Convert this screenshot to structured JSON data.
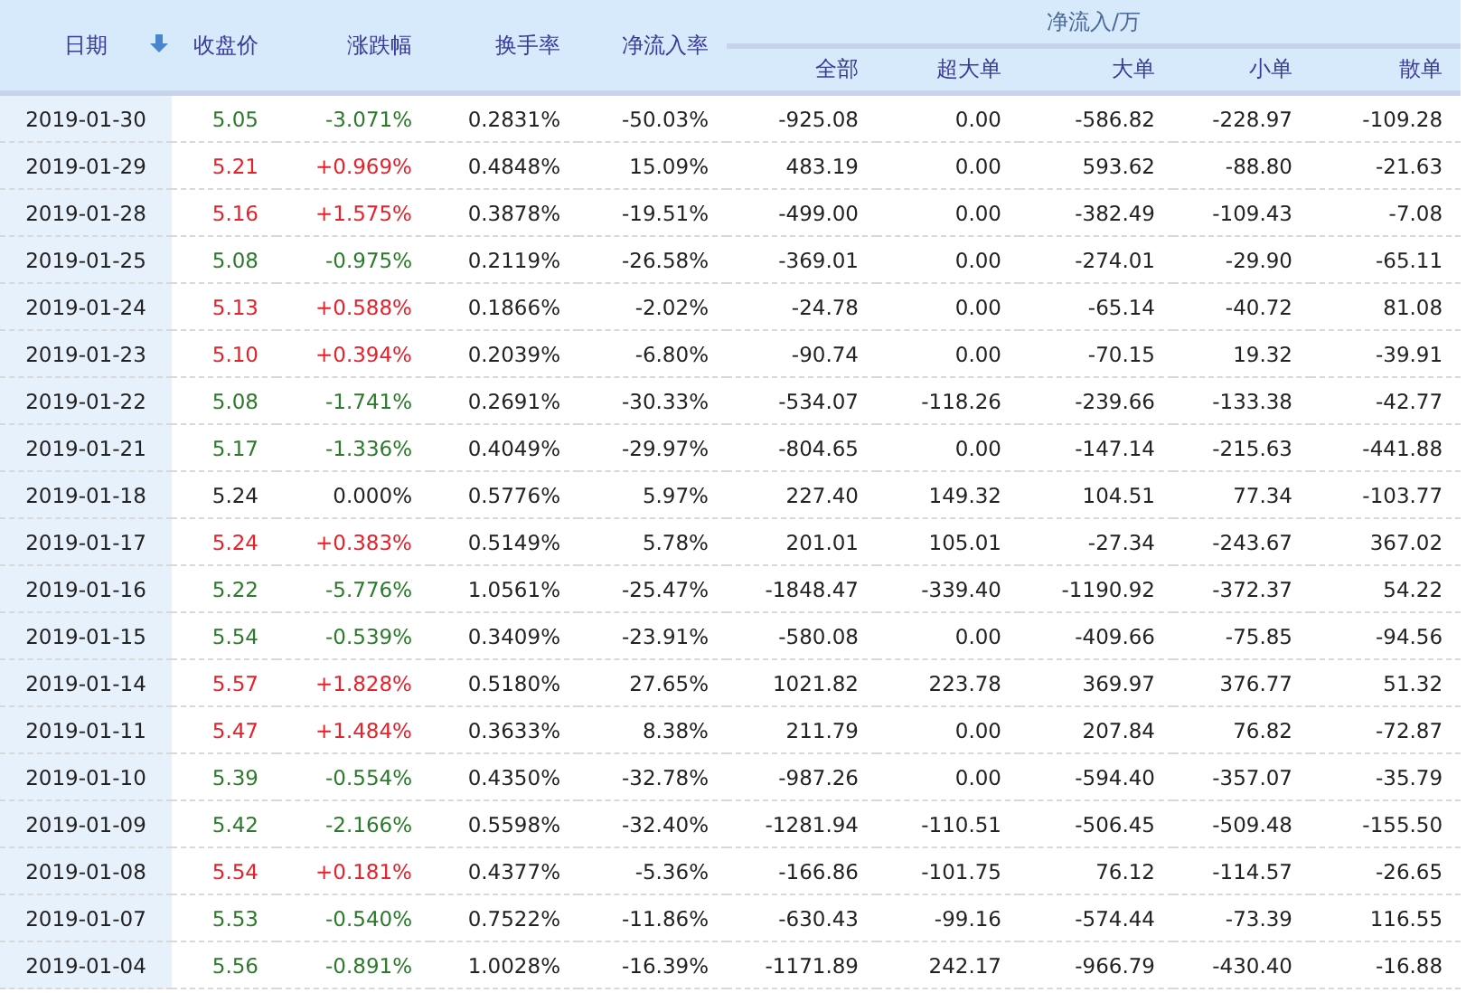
{
  "table": {
    "columns": [
      {
        "label": "日期",
        "sorted": true
      },
      {
        "label": "收盘价"
      },
      {
        "label": "涨跌幅"
      },
      {
        "label": "换手率"
      },
      {
        "label": "净流入率"
      }
    ],
    "group": {
      "label": "净流入/万",
      "columns": [
        "全部",
        "超大单",
        "大单",
        "小单",
        "散单"
      ]
    },
    "rows": [
      {
        "date": "2019-01-30",
        "color": "#2a7a2a",
        "close": "5.05",
        "change": "-3.071%",
        "turnover": "0.2831%",
        "rate": "-50.03%",
        "flows": [
          "-925.08",
          "0.00",
          "-586.82",
          "-228.97",
          "-109.28"
        ]
      },
      {
        "date": "2019-01-29",
        "color": "#e8202a",
        "close": "5.21",
        "change": "+0.969%",
        "turnover": "0.4848%",
        "rate": "15.09%",
        "flows": [
          "483.19",
          "0.00",
          "593.62",
          "-88.80",
          "-21.63"
        ]
      },
      {
        "date": "2019-01-28",
        "color": "#e8202a",
        "close": "5.16",
        "change": "+1.575%",
        "turnover": "0.3878%",
        "rate": "-19.51%",
        "flows": [
          "-499.00",
          "0.00",
          "-382.49",
          "-109.43",
          "-7.08"
        ]
      },
      {
        "date": "2019-01-25",
        "color": "#2a7a2a",
        "close": "5.08",
        "change": "-0.975%",
        "turnover": "0.2119%",
        "rate": "-26.58%",
        "flows": [
          "-369.01",
          "0.00",
          "-274.01",
          "-29.90",
          "-65.11"
        ]
      },
      {
        "date": "2019-01-24",
        "color": "#e8202a",
        "close": "5.13",
        "change": "+0.588%",
        "turnover": "0.1866%",
        "rate": "-2.02%",
        "flows": [
          "-24.78",
          "0.00",
          "-65.14",
          "-40.72",
          "81.08"
        ]
      },
      {
        "date": "2019-01-23",
        "color": "#e8202a",
        "close": "5.10",
        "change": "+0.394%",
        "turnover": "0.2039%",
        "rate": "-6.80%",
        "flows": [
          "-90.74",
          "0.00",
          "-70.15",
          "19.32",
          "-39.91"
        ]
      },
      {
        "date": "2019-01-22",
        "color": "#2a7a2a",
        "close": "5.08",
        "change": "-1.741%",
        "turnover": "0.2691%",
        "rate": "-30.33%",
        "flows": [
          "-534.07",
          "-118.26",
          "-239.66",
          "-133.38",
          "-42.77"
        ]
      },
      {
        "date": "2019-01-21",
        "color": "#2a7a2a",
        "close": "5.17",
        "change": "-1.336%",
        "turnover": "0.4049%",
        "rate": "-29.97%",
        "flows": [
          "-804.65",
          "0.00",
          "-147.14",
          "-215.63",
          "-441.88"
        ]
      },
      {
        "date": "2019-01-18",
        "color": "#222222",
        "close": "5.24",
        "change": "0.000%",
        "turnover": "0.5776%",
        "rate": "5.97%",
        "flows": [
          "227.40",
          "149.32",
          "104.51",
          "77.34",
          "-103.77"
        ]
      },
      {
        "date": "2019-01-17",
        "color": "#e8202a",
        "close": "5.24",
        "change": "+0.383%",
        "turnover": "0.5149%",
        "rate": "5.78%",
        "flows": [
          "201.01",
          "105.01",
          "-27.34",
          "-243.67",
          "367.02"
        ]
      },
      {
        "date": "2019-01-16",
        "color": "#2a7a2a",
        "close": "5.22",
        "change": "-5.776%",
        "turnover": "1.0561%",
        "rate": "-25.47%",
        "flows": [
          "-1848.47",
          "-339.40",
          "-1190.92",
          "-372.37",
          "54.22"
        ]
      },
      {
        "date": "2019-01-15",
        "color": "#2a7a2a",
        "close": "5.54",
        "change": "-0.539%",
        "turnover": "0.3409%",
        "rate": "-23.91%",
        "flows": [
          "-580.08",
          "0.00",
          "-409.66",
          "-75.85",
          "-94.56"
        ]
      },
      {
        "date": "2019-01-14",
        "color": "#e8202a",
        "close": "5.57",
        "change": "+1.828%",
        "turnover": "0.5180%",
        "rate": "27.65%",
        "flows": [
          "1021.82",
          "223.78",
          "369.97",
          "376.77",
          "51.32"
        ]
      },
      {
        "date": "2019-01-11",
        "color": "#e8202a",
        "close": "5.47",
        "change": "+1.484%",
        "turnover": "0.3633%",
        "rate": "8.38%",
        "flows": [
          "211.79",
          "0.00",
          "207.84",
          "76.82",
          "-72.87"
        ]
      },
      {
        "date": "2019-01-10",
        "color": "#2a7a2a",
        "close": "5.39",
        "change": "-0.554%",
        "turnover": "0.4350%",
        "rate": "-32.78%",
        "flows": [
          "-987.26",
          "0.00",
          "-594.40",
          "-357.07",
          "-35.79"
        ]
      },
      {
        "date": "2019-01-09",
        "color": "#2a7a2a",
        "close": "5.42",
        "change": "-2.166%",
        "turnover": "0.5598%",
        "rate": "-32.40%",
        "flows": [
          "-1281.94",
          "-110.51",
          "-506.45",
          "-509.48",
          "-155.50"
        ]
      },
      {
        "date": "2019-01-08",
        "color": "#e8202a",
        "close": "5.54",
        "change": "+0.181%",
        "turnover": "0.4377%",
        "rate": "-5.36%",
        "flows": [
          "-166.86",
          "-101.75",
          "76.12",
          "-114.57",
          "-26.65"
        ]
      },
      {
        "date": "2019-01-07",
        "color": "#2a7a2a",
        "close": "5.53",
        "change": "-0.540%",
        "turnover": "0.7522%",
        "rate": "-11.86%",
        "flows": [
          "-630.43",
          "-99.16",
          "-574.44",
          "-73.39",
          "116.55"
        ]
      },
      {
        "date": "2019-01-04",
        "color": "#2a7a2a",
        "close": "5.56",
        "change": "-0.891%",
        "turnover": "1.0028%",
        "rate": "-16.39%",
        "flows": [
          "-1171.89",
          "242.17",
          "-966.79",
          "-430.40",
          "-16.88"
        ]
      }
    ]
  }
}
